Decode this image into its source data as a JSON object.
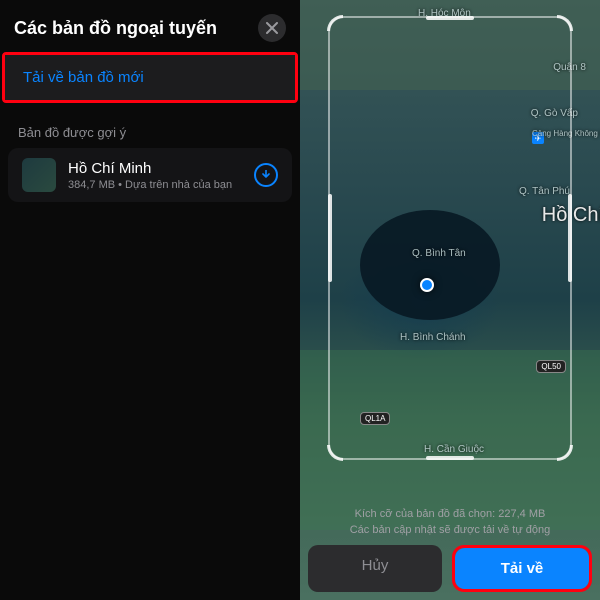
{
  "left": {
    "title": "Các bản đồ ngoại tuyến",
    "download_new": "Tải về bản đồ mới",
    "suggested_label": "Bản đồ được gợi ý",
    "suggested": {
      "name": "Hồ Chí Minh",
      "detail": "384,7 MB • Dựa trên nhà của bạn"
    }
  },
  "right": {
    "size_line": "Kích cỡ của bản đồ đã chọn: 227,4 MB",
    "update_line": "Các bản cập nhật sẽ được tải về tự động",
    "cancel": "Hủy",
    "download": "Tải về",
    "labels": {
      "hocmon": "H. Hóc Môn",
      "quan8": "Quận 8",
      "govap": "Q. Gò Vấp",
      "tanphu": "Q. Tân Phú",
      "binhtan": "Q. Bình Tân",
      "binhchanh": "H. Bình Chánh",
      "cangio": "H. Cần Giuộc",
      "hcm": "Hồ Chí",
      "airport": "Cảng Hàng Không Quốc Tế Tân Sơn Nhất (SGN)",
      "road50": "QL50",
      "road1a": "QL1A"
    }
  }
}
